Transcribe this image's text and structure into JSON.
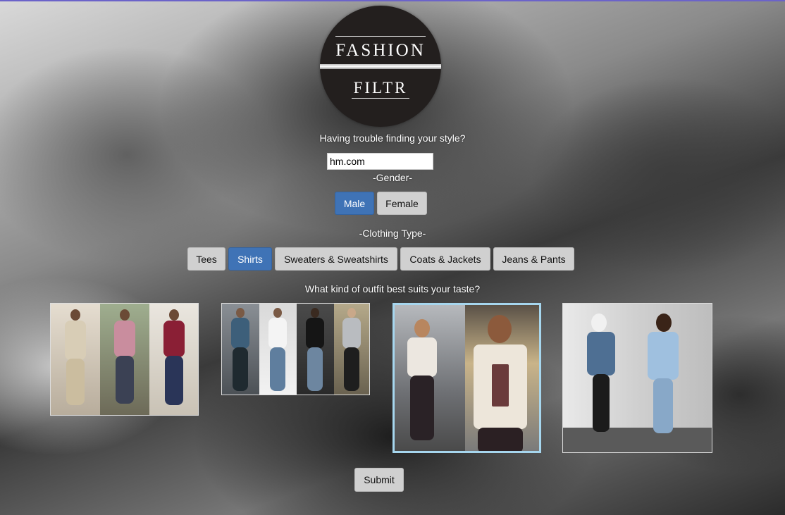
{
  "brand": {
    "line1": "FASHION",
    "line2": "FILTR"
  },
  "tagline": "Having trouble finding your style?",
  "site_field": {
    "value": "hm.com",
    "placeholder": ""
  },
  "gender": {
    "heading": "-Gender-",
    "options": [
      {
        "label": "Male",
        "active": true
      },
      {
        "label": "Female",
        "active": false
      }
    ]
  },
  "clothing": {
    "heading": "-Clothing Type-",
    "options": [
      {
        "label": "Tees",
        "active": false
      },
      {
        "label": "Shirts",
        "active": true
      },
      {
        "label": "Sweaters & Sweatshirts",
        "active": false
      },
      {
        "label": "Coats & Jackets",
        "active": false
      },
      {
        "label": "Jeans & Pants",
        "active": false
      }
    ]
  },
  "outfits": {
    "question": "What kind of outfit best suits your taste?",
    "selected_index": 2
  },
  "submit_label": "Submit",
  "colors": {
    "accent": "#3f73b6",
    "button": "#d0d0d0",
    "selected_border": "#a6d6ee",
    "logo": "#231f1e"
  }
}
